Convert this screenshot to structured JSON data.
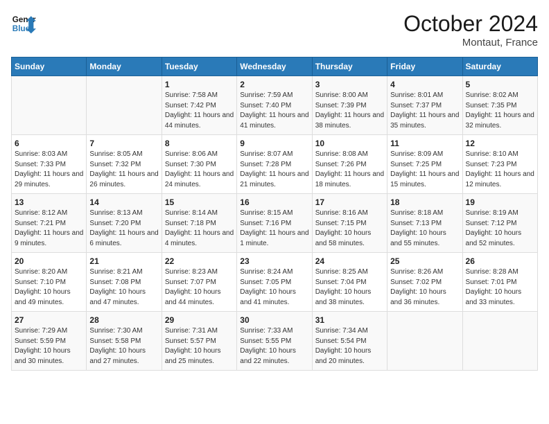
{
  "header": {
    "logo_line1": "General",
    "logo_line2": "Blue",
    "month": "October 2024",
    "location": "Montaut, France"
  },
  "days_of_week": [
    "Sunday",
    "Monday",
    "Tuesday",
    "Wednesday",
    "Thursday",
    "Friday",
    "Saturday"
  ],
  "weeks": [
    [
      {
        "day": "",
        "info": ""
      },
      {
        "day": "",
        "info": ""
      },
      {
        "day": "1",
        "info": "Sunrise: 7:58 AM\nSunset: 7:42 PM\nDaylight: 11 hours and 44 minutes."
      },
      {
        "day": "2",
        "info": "Sunrise: 7:59 AM\nSunset: 7:40 PM\nDaylight: 11 hours and 41 minutes."
      },
      {
        "day": "3",
        "info": "Sunrise: 8:00 AM\nSunset: 7:39 PM\nDaylight: 11 hours and 38 minutes."
      },
      {
        "day": "4",
        "info": "Sunrise: 8:01 AM\nSunset: 7:37 PM\nDaylight: 11 hours and 35 minutes."
      },
      {
        "day": "5",
        "info": "Sunrise: 8:02 AM\nSunset: 7:35 PM\nDaylight: 11 hours and 32 minutes."
      }
    ],
    [
      {
        "day": "6",
        "info": "Sunrise: 8:03 AM\nSunset: 7:33 PM\nDaylight: 11 hours and 29 minutes."
      },
      {
        "day": "7",
        "info": "Sunrise: 8:05 AM\nSunset: 7:32 PM\nDaylight: 11 hours and 26 minutes."
      },
      {
        "day": "8",
        "info": "Sunrise: 8:06 AM\nSunset: 7:30 PM\nDaylight: 11 hours and 24 minutes."
      },
      {
        "day": "9",
        "info": "Sunrise: 8:07 AM\nSunset: 7:28 PM\nDaylight: 11 hours and 21 minutes."
      },
      {
        "day": "10",
        "info": "Sunrise: 8:08 AM\nSunset: 7:26 PM\nDaylight: 11 hours and 18 minutes."
      },
      {
        "day": "11",
        "info": "Sunrise: 8:09 AM\nSunset: 7:25 PM\nDaylight: 11 hours and 15 minutes."
      },
      {
        "day": "12",
        "info": "Sunrise: 8:10 AM\nSunset: 7:23 PM\nDaylight: 11 hours and 12 minutes."
      }
    ],
    [
      {
        "day": "13",
        "info": "Sunrise: 8:12 AM\nSunset: 7:21 PM\nDaylight: 11 hours and 9 minutes."
      },
      {
        "day": "14",
        "info": "Sunrise: 8:13 AM\nSunset: 7:20 PM\nDaylight: 11 hours and 6 minutes."
      },
      {
        "day": "15",
        "info": "Sunrise: 8:14 AM\nSunset: 7:18 PM\nDaylight: 11 hours and 4 minutes."
      },
      {
        "day": "16",
        "info": "Sunrise: 8:15 AM\nSunset: 7:16 PM\nDaylight: 11 hours and 1 minute."
      },
      {
        "day": "17",
        "info": "Sunrise: 8:16 AM\nSunset: 7:15 PM\nDaylight: 10 hours and 58 minutes."
      },
      {
        "day": "18",
        "info": "Sunrise: 8:18 AM\nSunset: 7:13 PM\nDaylight: 10 hours and 55 minutes."
      },
      {
        "day": "19",
        "info": "Sunrise: 8:19 AM\nSunset: 7:12 PM\nDaylight: 10 hours and 52 minutes."
      }
    ],
    [
      {
        "day": "20",
        "info": "Sunrise: 8:20 AM\nSunset: 7:10 PM\nDaylight: 10 hours and 49 minutes."
      },
      {
        "day": "21",
        "info": "Sunrise: 8:21 AM\nSunset: 7:08 PM\nDaylight: 10 hours and 47 minutes."
      },
      {
        "day": "22",
        "info": "Sunrise: 8:23 AM\nSunset: 7:07 PM\nDaylight: 10 hours and 44 minutes."
      },
      {
        "day": "23",
        "info": "Sunrise: 8:24 AM\nSunset: 7:05 PM\nDaylight: 10 hours and 41 minutes."
      },
      {
        "day": "24",
        "info": "Sunrise: 8:25 AM\nSunset: 7:04 PM\nDaylight: 10 hours and 38 minutes."
      },
      {
        "day": "25",
        "info": "Sunrise: 8:26 AM\nSunset: 7:02 PM\nDaylight: 10 hours and 36 minutes."
      },
      {
        "day": "26",
        "info": "Sunrise: 8:28 AM\nSunset: 7:01 PM\nDaylight: 10 hours and 33 minutes."
      }
    ],
    [
      {
        "day": "27",
        "info": "Sunrise: 7:29 AM\nSunset: 5:59 PM\nDaylight: 10 hours and 30 minutes."
      },
      {
        "day": "28",
        "info": "Sunrise: 7:30 AM\nSunset: 5:58 PM\nDaylight: 10 hours and 27 minutes."
      },
      {
        "day": "29",
        "info": "Sunrise: 7:31 AM\nSunset: 5:57 PM\nDaylight: 10 hours and 25 minutes."
      },
      {
        "day": "30",
        "info": "Sunrise: 7:33 AM\nSunset: 5:55 PM\nDaylight: 10 hours and 22 minutes."
      },
      {
        "day": "31",
        "info": "Sunrise: 7:34 AM\nSunset: 5:54 PM\nDaylight: 10 hours and 20 minutes."
      },
      {
        "day": "",
        "info": ""
      },
      {
        "day": "",
        "info": ""
      }
    ]
  ]
}
